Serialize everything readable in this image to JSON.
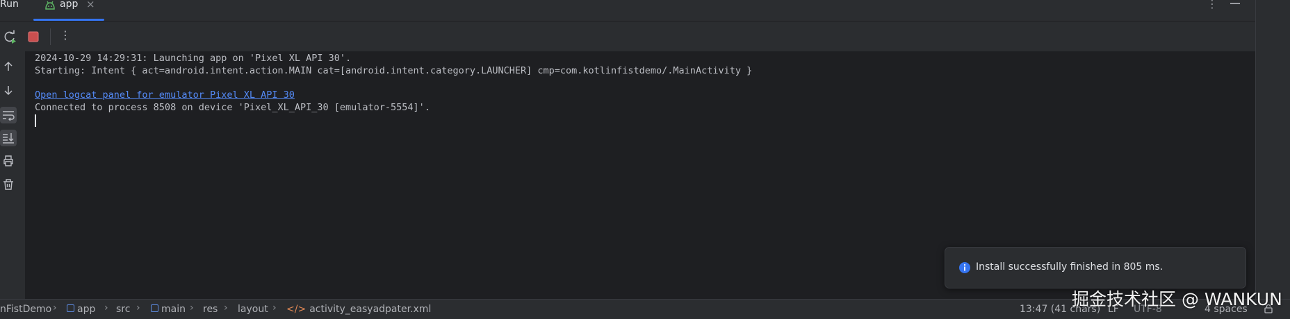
{
  "tool_window": {
    "title": "Run",
    "tab": {
      "label": "app",
      "close": "×",
      "icon": "android-icon"
    },
    "more_label": "⋮"
  },
  "toolbar": {
    "rerun_icon": "rerun-icon",
    "stop_icon": "stop-icon",
    "more_label": "⋮"
  },
  "gutter": {
    "items": [
      "arrow-up-icon",
      "arrow-down-icon",
      "soft-wrap-icon",
      "scroll-to-end-icon",
      "print-icon",
      "trash-icon"
    ]
  },
  "console": {
    "lines": [
      "2024-10-29 14:29:31: Launching app on 'Pixel XL API 30'.",
      "Starting: Intent { act=android.intent.action.MAIN cat=[android.intent.category.LAUNCHER] cmp=com.kotlinfistdemo/.MainActivity }",
      "Connected to process 8508 on device 'Pixel_XL_API_30 [emulator-5554]'."
    ],
    "link": "Open logcat panel for emulator Pixel XL API 30"
  },
  "notification": {
    "message": "Install successfully finished in 805 ms.",
    "icon": "info-icon"
  },
  "statusbar": {
    "breadcrumbs": [
      "nFistDemo",
      "app",
      "src",
      "main",
      "res",
      "layout",
      "activity_easyadpater.xml"
    ],
    "position": "13:47 (41 chars)",
    "line_separator": "LF",
    "encoding": "UTF-8",
    "indent": "4 spaces"
  },
  "watermark": "掘金技术社区 @ WANKUN",
  "colors": {
    "accent": "#3574f0",
    "link": "#548af7",
    "stop": "#c94f4f",
    "info": "#3574f0"
  }
}
